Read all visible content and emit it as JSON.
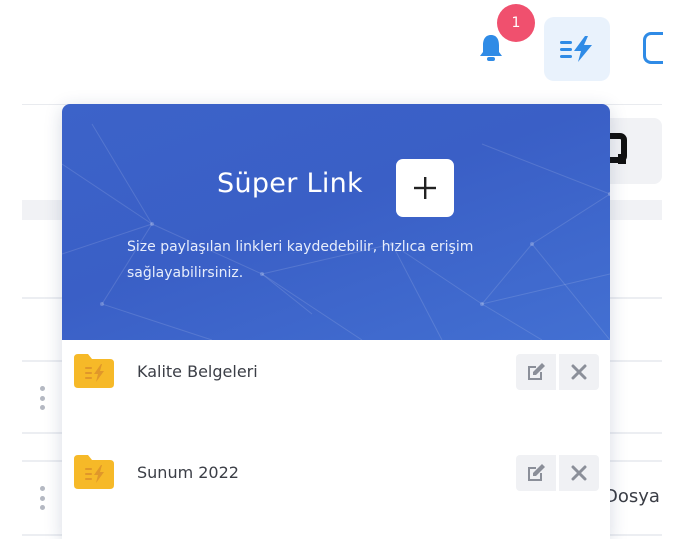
{
  "header": {
    "notification_count": "1",
    "icons": {
      "notifications": "bell-icon",
      "super_link": "lightning-list-icon"
    }
  },
  "popup": {
    "title": "Süper Link",
    "description": "Size paylaşılan linkleri kaydedebilir, hızlıca erişim sağlayabilirsiniz.",
    "icons": {
      "add": "plus-icon",
      "edit": "edit-icon",
      "delete": "close-icon",
      "folder": "folder-icon"
    },
    "items": [
      {
        "label": "Kalite Belgeleri"
      },
      {
        "label": "Sunum 2022"
      }
    ]
  },
  "background": {
    "partial_text": "Dosya"
  },
  "colors": {
    "accent_blue": "#3c63c9",
    "badge_red": "#f0506e",
    "folder_yellow": "#f6b928",
    "lightning_blue": "#2f8be6"
  }
}
